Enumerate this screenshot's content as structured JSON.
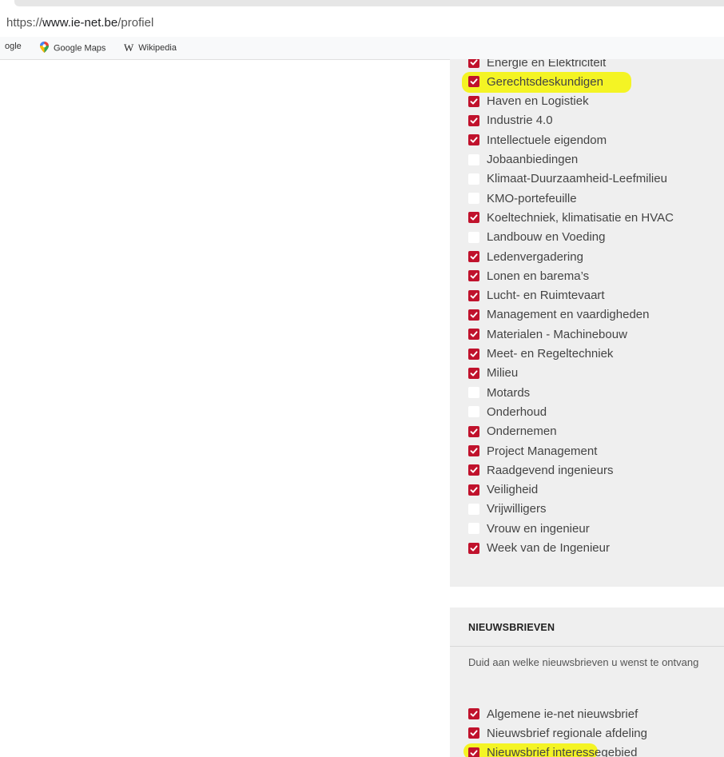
{
  "browser": {
    "url_prefix": "https://",
    "url_host": "www.ie-net.be",
    "url_path": "/profiel",
    "bookmarks": [
      {
        "label": "ogle",
        "icon": "google-icon"
      },
      {
        "label": "Google Maps",
        "icon": "map-pin-icon"
      },
      {
        "label": "Wikipedia",
        "icon": "wikipedia-icon"
      }
    ]
  },
  "colors": {
    "checked": "#c0122c",
    "highlight": "#f4f400",
    "panel_bg": "#efefef"
  },
  "interests": [
    {
      "label": "Energie en Elektriciteit",
      "checked": true
    },
    {
      "label": "Gerechtsdeskundigen",
      "checked": true
    },
    {
      "label": "Haven en Logistiek",
      "checked": true
    },
    {
      "label": "Industrie 4.0",
      "checked": true
    },
    {
      "label": "Intellectuele eigendom",
      "checked": true
    },
    {
      "label": "Jobaanbiedingen",
      "checked": false
    },
    {
      "label": "Klimaat-Duurzaamheid-Leefmilieu",
      "checked": false
    },
    {
      "label": "KMO-portefeuille",
      "checked": false
    },
    {
      "label": "Koeltechniek, klimatisatie en HVAC",
      "checked": true
    },
    {
      "label": "Landbouw en Voeding",
      "checked": false
    },
    {
      "label": "Ledenvergadering",
      "checked": true
    },
    {
      "label": "Lonen en barema’s",
      "checked": true
    },
    {
      "label": "Lucht- en Ruimtevaart",
      "checked": true
    },
    {
      "label": "Management en vaardigheden",
      "checked": true
    },
    {
      "label": "Materialen - Machinebouw",
      "checked": true
    },
    {
      "label": "Meet- en Regeltechniek",
      "checked": true
    },
    {
      "label": "Milieu",
      "checked": true
    },
    {
      "label": "Motards",
      "checked": false
    },
    {
      "label": "Onderhoud",
      "checked": false
    },
    {
      "label": "Ondernemen",
      "checked": true
    },
    {
      "label": "Project Management",
      "checked": true
    },
    {
      "label": "Raadgevend ingenieurs",
      "checked": true
    },
    {
      "label": "Veiligheid",
      "checked": true
    },
    {
      "label": "Vrijwilligers",
      "checked": false
    },
    {
      "label": "Vrouw en ingenieur",
      "checked": false
    },
    {
      "label": "Week van de Ingenieur",
      "checked": true
    }
  ],
  "newsletters": {
    "title": "NIEUWSBRIEVEN",
    "description": "Duid aan welke nieuwsbrieven u wenst te ontvang",
    "items": [
      {
        "label": "Algemene ie-net nieuwsbrief",
        "checked": true
      },
      {
        "label": "Nieuwsbrief regionale afdeling",
        "checked": true
      },
      {
        "label": "Nieuwsbrief interessegebied",
        "checked": true
      }
    ]
  }
}
